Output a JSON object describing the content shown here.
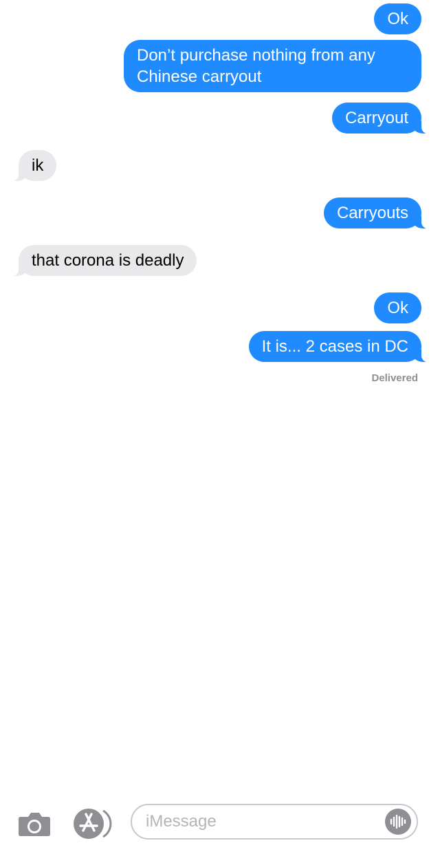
{
  "conversation": {
    "messages": [
      {
        "side": "sent",
        "text": "Ok"
      },
      {
        "side": "sent",
        "text": "Don’t purchase nothing from any\nChinese carryout"
      },
      {
        "side": "sent",
        "text": "Carryout"
      },
      {
        "side": "received",
        "text": "ik"
      },
      {
        "side": "sent",
        "text": "Carryouts"
      },
      {
        "side": "received",
        "text": "that corona is deadly"
      },
      {
        "side": "sent",
        "text": "Ok"
      },
      {
        "side": "sent",
        "text": "It is... 2 cases in DC"
      }
    ],
    "status": "Delivered"
  },
  "composer": {
    "placeholder": "iMessage",
    "value": "",
    "icons": {
      "camera": "camera-icon",
      "app_store": "app-store-icon",
      "audio": "audio-waveform-icon"
    }
  },
  "colors": {
    "sent_bubble": "#1f8bff",
    "received_bubble": "#e9e9eb",
    "status_text": "#8e8e93"
  }
}
